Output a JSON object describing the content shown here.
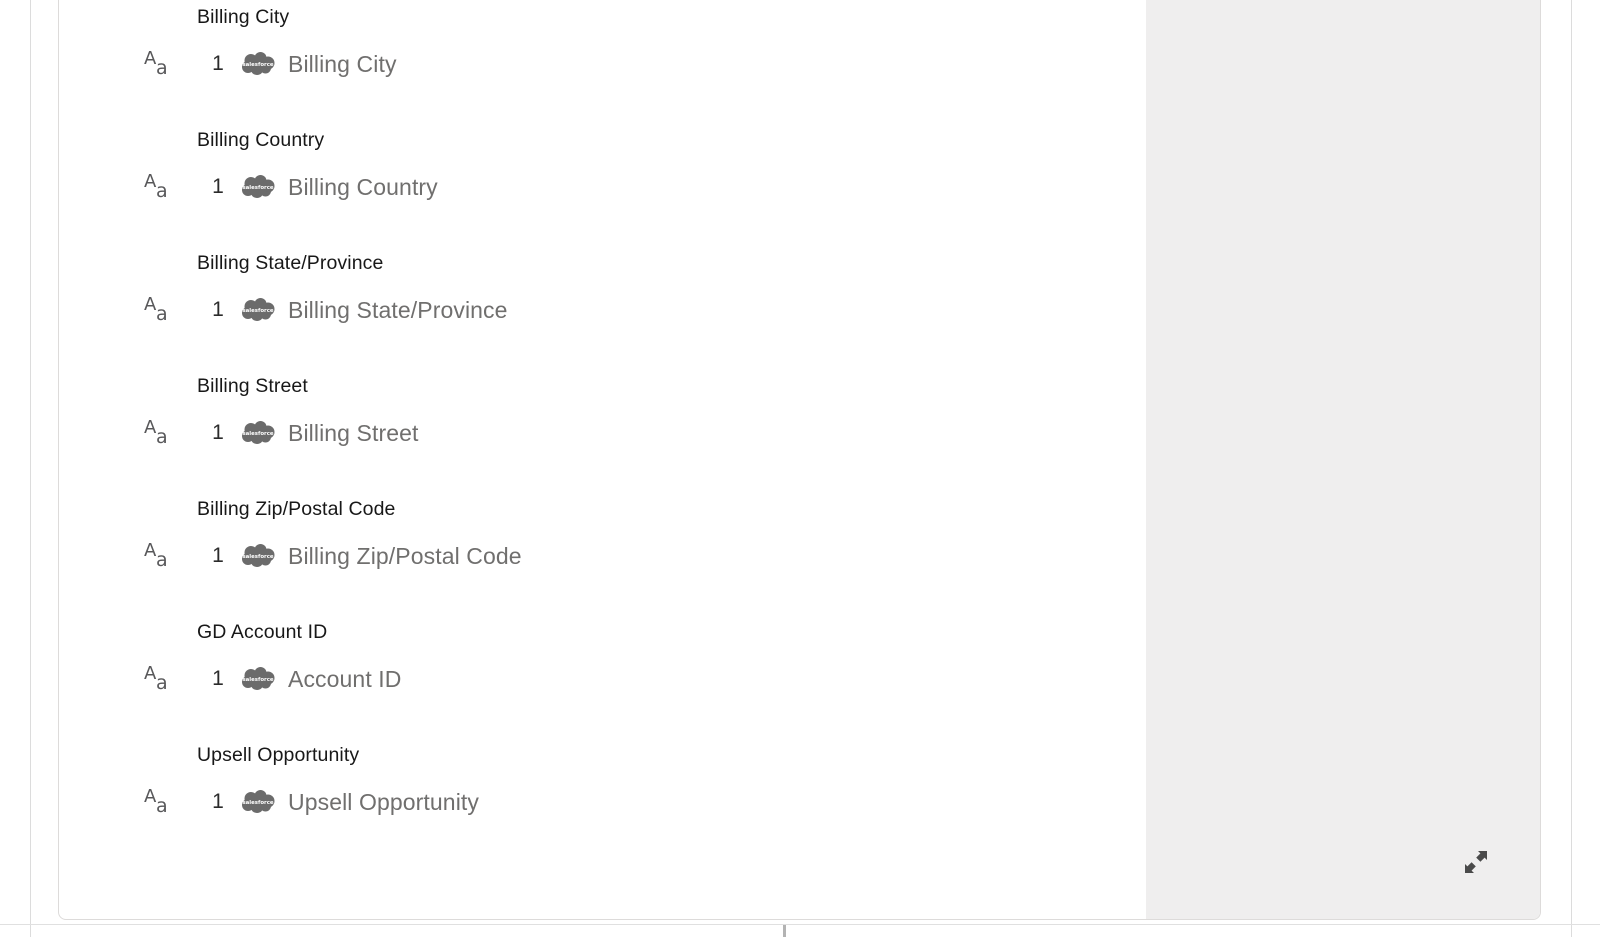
{
  "panel": {
    "expand_icon": "expand-arrows-icon"
  },
  "mappings": [
    {
      "label": "Billing City",
      "type_icon": "text-type-icon",
      "count": "1",
      "source_icon": "salesforce-cloud-icon",
      "value": "Billing City"
    },
    {
      "label": "Billing Country",
      "type_icon": "text-type-icon",
      "count": "1",
      "source_icon": "salesforce-cloud-icon",
      "value": "Billing Country"
    },
    {
      "label": "Billing State/Province",
      "type_icon": "text-type-icon",
      "count": "1",
      "source_icon": "salesforce-cloud-icon",
      "value": "Billing State/Province"
    },
    {
      "label": "Billing Street",
      "type_icon": "text-type-icon",
      "count": "1",
      "source_icon": "salesforce-cloud-icon",
      "value": "Billing Street"
    },
    {
      "label": "Billing Zip/Postal Code",
      "type_icon": "text-type-icon",
      "count": "1",
      "source_icon": "salesforce-cloud-icon",
      "value": "Billing Zip/Postal Code"
    },
    {
      "label": "GD Account ID",
      "type_icon": "text-type-icon",
      "count": "1",
      "source_icon": "salesforce-cloud-icon",
      "value": "Account ID"
    },
    {
      "label": "Upsell Opportunity",
      "type_icon": "text-type-icon",
      "count": "1",
      "source_icon": "salesforce-cloud-icon",
      "value": "Upsell Opportunity"
    }
  ],
  "icon_glyphs": {
    "type_upper": "A",
    "type_lower": "a"
  },
  "colors": {
    "panel_border": "#dddbda",
    "preview_pane": "#efeeee",
    "label_text": "#181818",
    "value_text": "#706f6e",
    "icon_gray": "#58585a",
    "salesforce_cloud": "#6b6b6b"
  }
}
